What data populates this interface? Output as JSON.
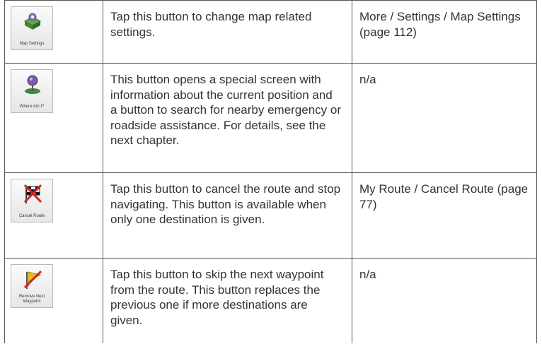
{
  "rows": [
    {
      "icon": "map-settings-icon",
      "button_caption": "Map Settings",
      "description": "Tap this button to change map related settings.",
      "reference": "More / Settings / Map Settings (page 112)"
    },
    {
      "icon": "where-am-i-icon",
      "button_caption": "Where Am I?",
      "description": "This button opens a special screen with information about the current position and a button to search for nearby emergency or roadside assistance. For details, see the next chapter.",
      "reference": "n/a"
    },
    {
      "icon": "cancel-route-icon",
      "button_caption": "Cancel Route",
      "description": "Tap this button to cancel the route and stop navigating. This button is available when only one destination is given.",
      "reference": "My Route / Cancel Route (page 77)"
    },
    {
      "icon": "remove-next-waypoint-icon",
      "button_caption": "Remove Next Waypoint",
      "description": "Tap this button to skip the next waypoint from the route. This button replaces the previous one if more destinations are given.",
      "reference": "n/a"
    }
  ],
  "colors": {
    "border": "#555555",
    "text": "#333333",
    "icon_green": "#3d8a3a",
    "icon_purple": "#7a5aa8",
    "flag_red": "#cc2222",
    "flag_yellow": "#e0c020"
  }
}
